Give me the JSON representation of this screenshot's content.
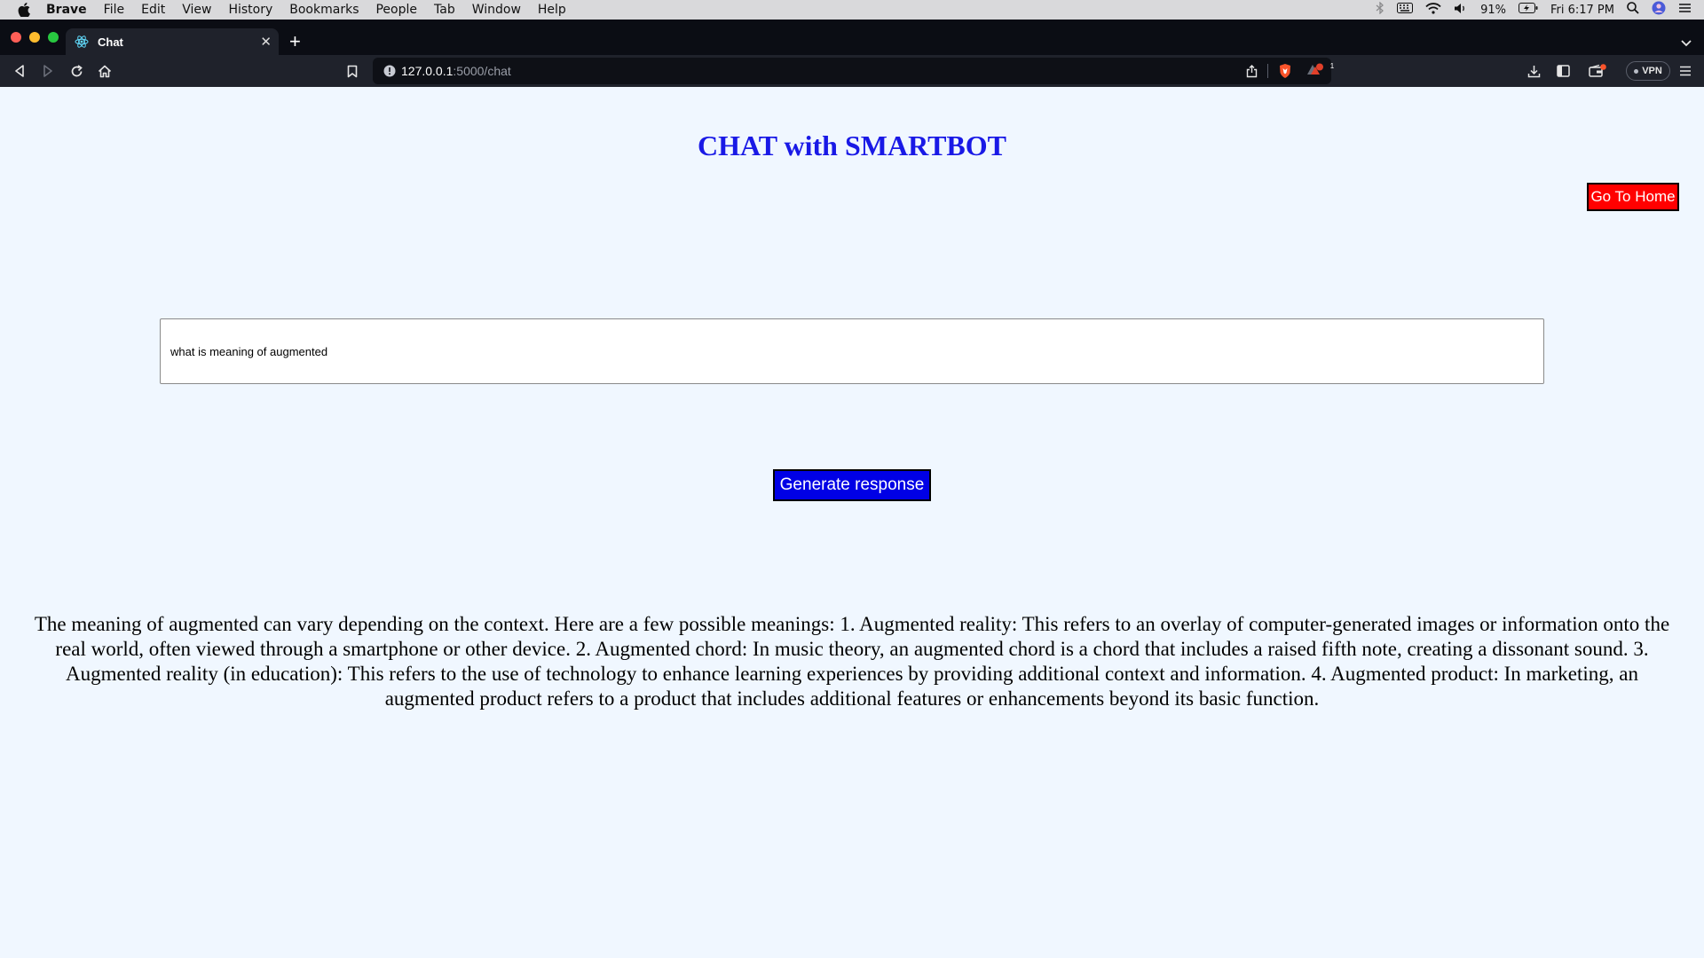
{
  "menubar": {
    "app_name": "Brave",
    "items": [
      "File",
      "Edit",
      "View",
      "History",
      "Bookmarks",
      "People",
      "Tab",
      "Window",
      "Help"
    ],
    "battery": "91%",
    "clock": "Fri 6:17 PM"
  },
  "tab": {
    "title": "Chat",
    "close_glyph": "✕",
    "new_tab_glyph": "+"
  },
  "toolbar": {
    "url_host": "127.0.0.1",
    "url_path": ":5000/chat",
    "vpn_label": "VPN",
    "alert_badge_count": "1"
  },
  "page": {
    "title": "CHAT with SMARTBOT",
    "home_button": "Go To Home",
    "query_value": "what is meaning of augmented",
    "generate_button": "Generate response",
    "response_text": "The meaning of augmented can vary depending on the context. Here are a few possible meanings: 1. Augmented reality: This refers to an overlay of computer-generated images or information onto the real world, often viewed through a smartphone or other device. 2. Augmented chord: In music theory, an augmented chord is a chord that includes a raised fifth note, creating a dissonant sound. 3. Augmented reality (in education): This refers to the use of technology to enhance learning experiences by providing additional context and information. 4. Augmented product: In marketing, an augmented product refers to a product that includes additional features or enhancements beyond its basic function."
  },
  "colors": {
    "page_bg": "#f0f7ff",
    "title": "#1919e6",
    "home_button": "#ff0000",
    "generate_button": "#0000e6"
  }
}
